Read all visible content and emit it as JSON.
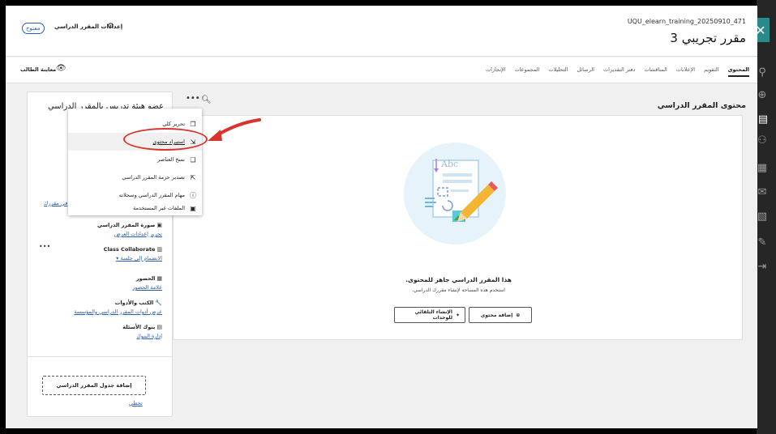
{
  "header": {
    "status_badge": "مفتوح",
    "settings_label": "إعدادات المقرر الدراسي",
    "course_code": "UQU_elearn_training_20250910_471",
    "course_title": "مقرر تجريبي 3"
  },
  "navbar": {
    "student_preview": "معاينة الطالب",
    "tabs": [
      {
        "label": "المحتوى",
        "active": true
      },
      {
        "label": "التقويم"
      },
      {
        "label": "الإعلانات"
      },
      {
        "label": "المناقشات"
      },
      {
        "label": "دفتر التقديرات"
      },
      {
        "label": "الرسائل"
      },
      {
        "label": "التحليلات"
      },
      {
        "label": "المجموعات"
      },
      {
        "label": "الإنجازات"
      }
    ]
  },
  "left_panel": {
    "title": "عضو هيئة تدريس بالمقرر الدراسي",
    "course_link": "في مقررك",
    "items": [
      {
        "title": "صورة المقرر الدراسي",
        "link": "تحرير إعدادات العرض",
        "icon": "image-icon"
      },
      {
        "title": "Class Collaborate",
        "link": "الانضمام إلى جلسة ▾",
        "icon": "collaborate-icon"
      },
      {
        "title": "الحضور",
        "link": "علامة الحضور",
        "icon": "attendance-icon"
      },
      {
        "title": "الكتب والأدوات",
        "link": "عرض أدوات المقرر الدراسي والمؤسسة",
        "icon": "tools-icon"
      },
      {
        "title": "بنوك الأسئلة",
        "link": "إدارة البنوك",
        "icon": "bank-icon"
      }
    ],
    "add_schedule": "إضافة جدول المقرر الدراسي",
    "skip": "تخطي"
  },
  "dropdown": {
    "items": [
      {
        "label": "تحرير كلي",
        "icon": "bulk-edit-icon"
      },
      {
        "label": "استيراد محتوى",
        "icon": "import-icon",
        "highlighted": true
      },
      {
        "label": "نسخ العناصر",
        "icon": "copy-icon"
      },
      {
        "label": "تصدير حزمة المقرر الدراسي",
        "icon": "export-icon"
      },
      {
        "label": "مهام المقرر الدراسي وسجلاته",
        "icon": "info-icon"
      },
      {
        "label": "الملفات غير المستخدمة",
        "icon": "files-icon"
      }
    ]
  },
  "main": {
    "heading": "محتوى المقرر الدراسي",
    "ready_title": "هذا المقرر الدراسي جاهز للمحتوى.",
    "ready_subtitle": "استخدم هذه المساحة لإنشاء مقررك الدراسي.",
    "add_content": "إضافة محتوى",
    "ai_design": "الإنشاء التلقائي للوحدات",
    "illustration_text": "Abc"
  },
  "colors": {
    "accent": "#2a8a8a",
    "link": "#2a5db0",
    "annotation": "#d9342b"
  }
}
